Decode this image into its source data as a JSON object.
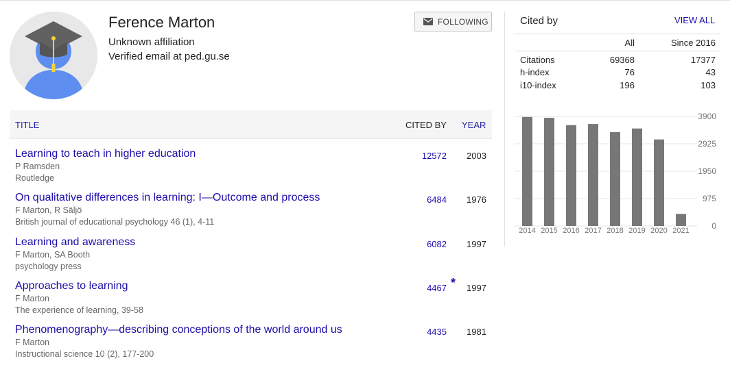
{
  "profile": {
    "name": "Ference Marton",
    "affiliation": "Unknown affiliation",
    "email": "Verified email at ped.gu.se",
    "follow_label": "FOLLOWING"
  },
  "table": {
    "col_title": "TITLE",
    "col_cited_by": "CITED BY",
    "col_year": "YEAR",
    "rows": [
      {
        "title": "Learning to teach in higher education",
        "authors": "P Ramsden",
        "venue": "Routledge",
        "cited_by": "12572",
        "year": "2003",
        "star": ""
      },
      {
        "title": "On qualitative differences in learning: I—Outcome and process",
        "authors": "F Marton, R Säljö",
        "venue": "British journal of educational psychology 46 (1), 4-11",
        "cited_by": "6484",
        "year": "1976",
        "star": ""
      },
      {
        "title": "Learning and awareness",
        "authors": "F Marton, SA Booth",
        "venue": "psychology press",
        "cited_by": "6082",
        "year": "1997",
        "star": ""
      },
      {
        "title": "Approaches to learning",
        "authors": "F Marton",
        "venue": "The experience of learning, 39-58",
        "cited_by": "4467",
        "year": "1997",
        "star": "*"
      },
      {
        "title": "Phenomenography—describing conceptions of the world around us",
        "authors": "F Marton",
        "venue": "Instructional science 10 (2), 177-200",
        "cited_by": "4435",
        "year": "1981",
        "star": ""
      }
    ]
  },
  "cited_by": {
    "title": "Cited by",
    "view_all": "VIEW ALL",
    "col_all": "All",
    "col_since": "Since 2016",
    "metrics": [
      {
        "label": "Citations",
        "all": "69368",
        "since": "17377"
      },
      {
        "label": "h-index",
        "all": "76",
        "since": "43"
      },
      {
        "label": "i10-index",
        "all": "196",
        "since": "103"
      }
    ]
  },
  "chart_data": {
    "type": "bar",
    "categories": [
      "2014",
      "2015",
      "2016",
      "2017",
      "2018",
      "2019",
      "2020",
      "2021"
    ],
    "values": [
      3880,
      3850,
      3590,
      3630,
      3340,
      3470,
      3080,
      430
    ],
    "y_ticks": [
      "0",
      "975",
      "1950",
      "2925",
      "3900"
    ],
    "ylim": [
      0,
      3900
    ],
    "grid": true,
    "bar_color": "#777777"
  },
  "colors": {
    "link": "#1a0dab",
    "header_bg": "#f5f5f5",
    "avatar_body": "#5e8ef0"
  }
}
